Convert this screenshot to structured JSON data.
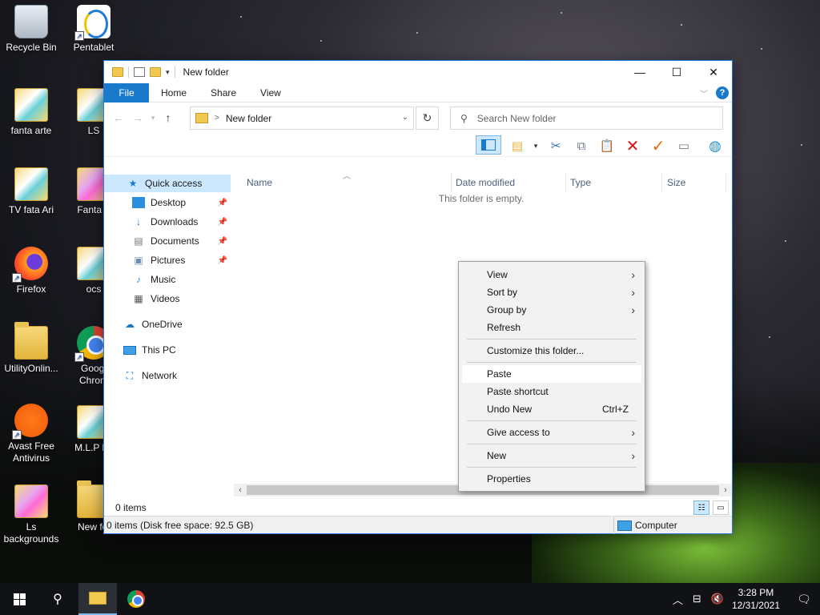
{
  "desktop": {
    "icons": [
      {
        "label": "Recycle Bin",
        "icon": "recycle-bin-icon"
      },
      {
        "label": "Pentablet",
        "icon": "pentablet-icon"
      },
      {
        "label": "fanta arte",
        "icon": "folder-icon"
      },
      {
        "label": "LS",
        "icon": "folder-icon"
      },
      {
        "label": "TV  fata Ari",
        "icon": "folder-icon"
      },
      {
        "label": "Fanta A",
        "icon": "folder-icon"
      },
      {
        "label": "Firefox",
        "icon": "firefox-icon"
      },
      {
        "label": "ocs",
        "icon": "folder-icon"
      },
      {
        "label": "UtilityOnlin...",
        "icon": "folder-icon"
      },
      {
        "label": "Googl",
        "label2": "Chrom",
        "icon": "chrome-icon"
      },
      {
        "label": "Avast Free",
        "label2": "Antivirus",
        "icon": "avast-icon"
      },
      {
        "label": "M.L.P ba",
        "icon": "folder-icon"
      },
      {
        "label": "Ls",
        "label2": "backgrounds",
        "icon": "folder-icon"
      },
      {
        "label": "New fol",
        "icon": "folder-icon"
      }
    ]
  },
  "window": {
    "title": "New folder",
    "controls": {
      "minimize": "—",
      "maximize": "☐",
      "close": "✕"
    },
    "ribbon_tabs": [
      "File",
      "Home",
      "Share",
      "View"
    ],
    "help": "?",
    "address": {
      "crumb": "New folder",
      "separator": ">"
    },
    "search_placeholder": "Search New folder",
    "columns": [
      "Name",
      "Date modified",
      "Type",
      "Size"
    ],
    "empty_text": "This folder is empty.",
    "nav": {
      "quick_access": "Quick access",
      "desktop": "Desktop",
      "downloads": "Downloads",
      "documents": "Documents",
      "pictures": "Pictures",
      "music": "Music",
      "videos": "Videos",
      "onedrive": "OneDrive",
      "this_pc": "This PC",
      "network": "Network"
    },
    "items_count": "0 items",
    "status": "0 items (Disk free space: 92.5 GB)",
    "status_right": "Computer"
  },
  "context_menu": {
    "view": "View",
    "sort_by": "Sort by",
    "group_by": "Group by",
    "refresh": "Refresh",
    "customize": "Customize this folder...",
    "paste": "Paste",
    "paste_shortcut": "Paste shortcut",
    "undo_new": "Undo New",
    "undo_shortcut": "Ctrl+Z",
    "give_access": "Give access to",
    "new": "New",
    "properties": "Properties"
  },
  "taskbar": {
    "time": "3:28 PM",
    "date": "12/31/2021"
  },
  "colors": {
    "accent": "#1979ca",
    "selection": "#cce8ff",
    "taskbar": "#101216"
  }
}
